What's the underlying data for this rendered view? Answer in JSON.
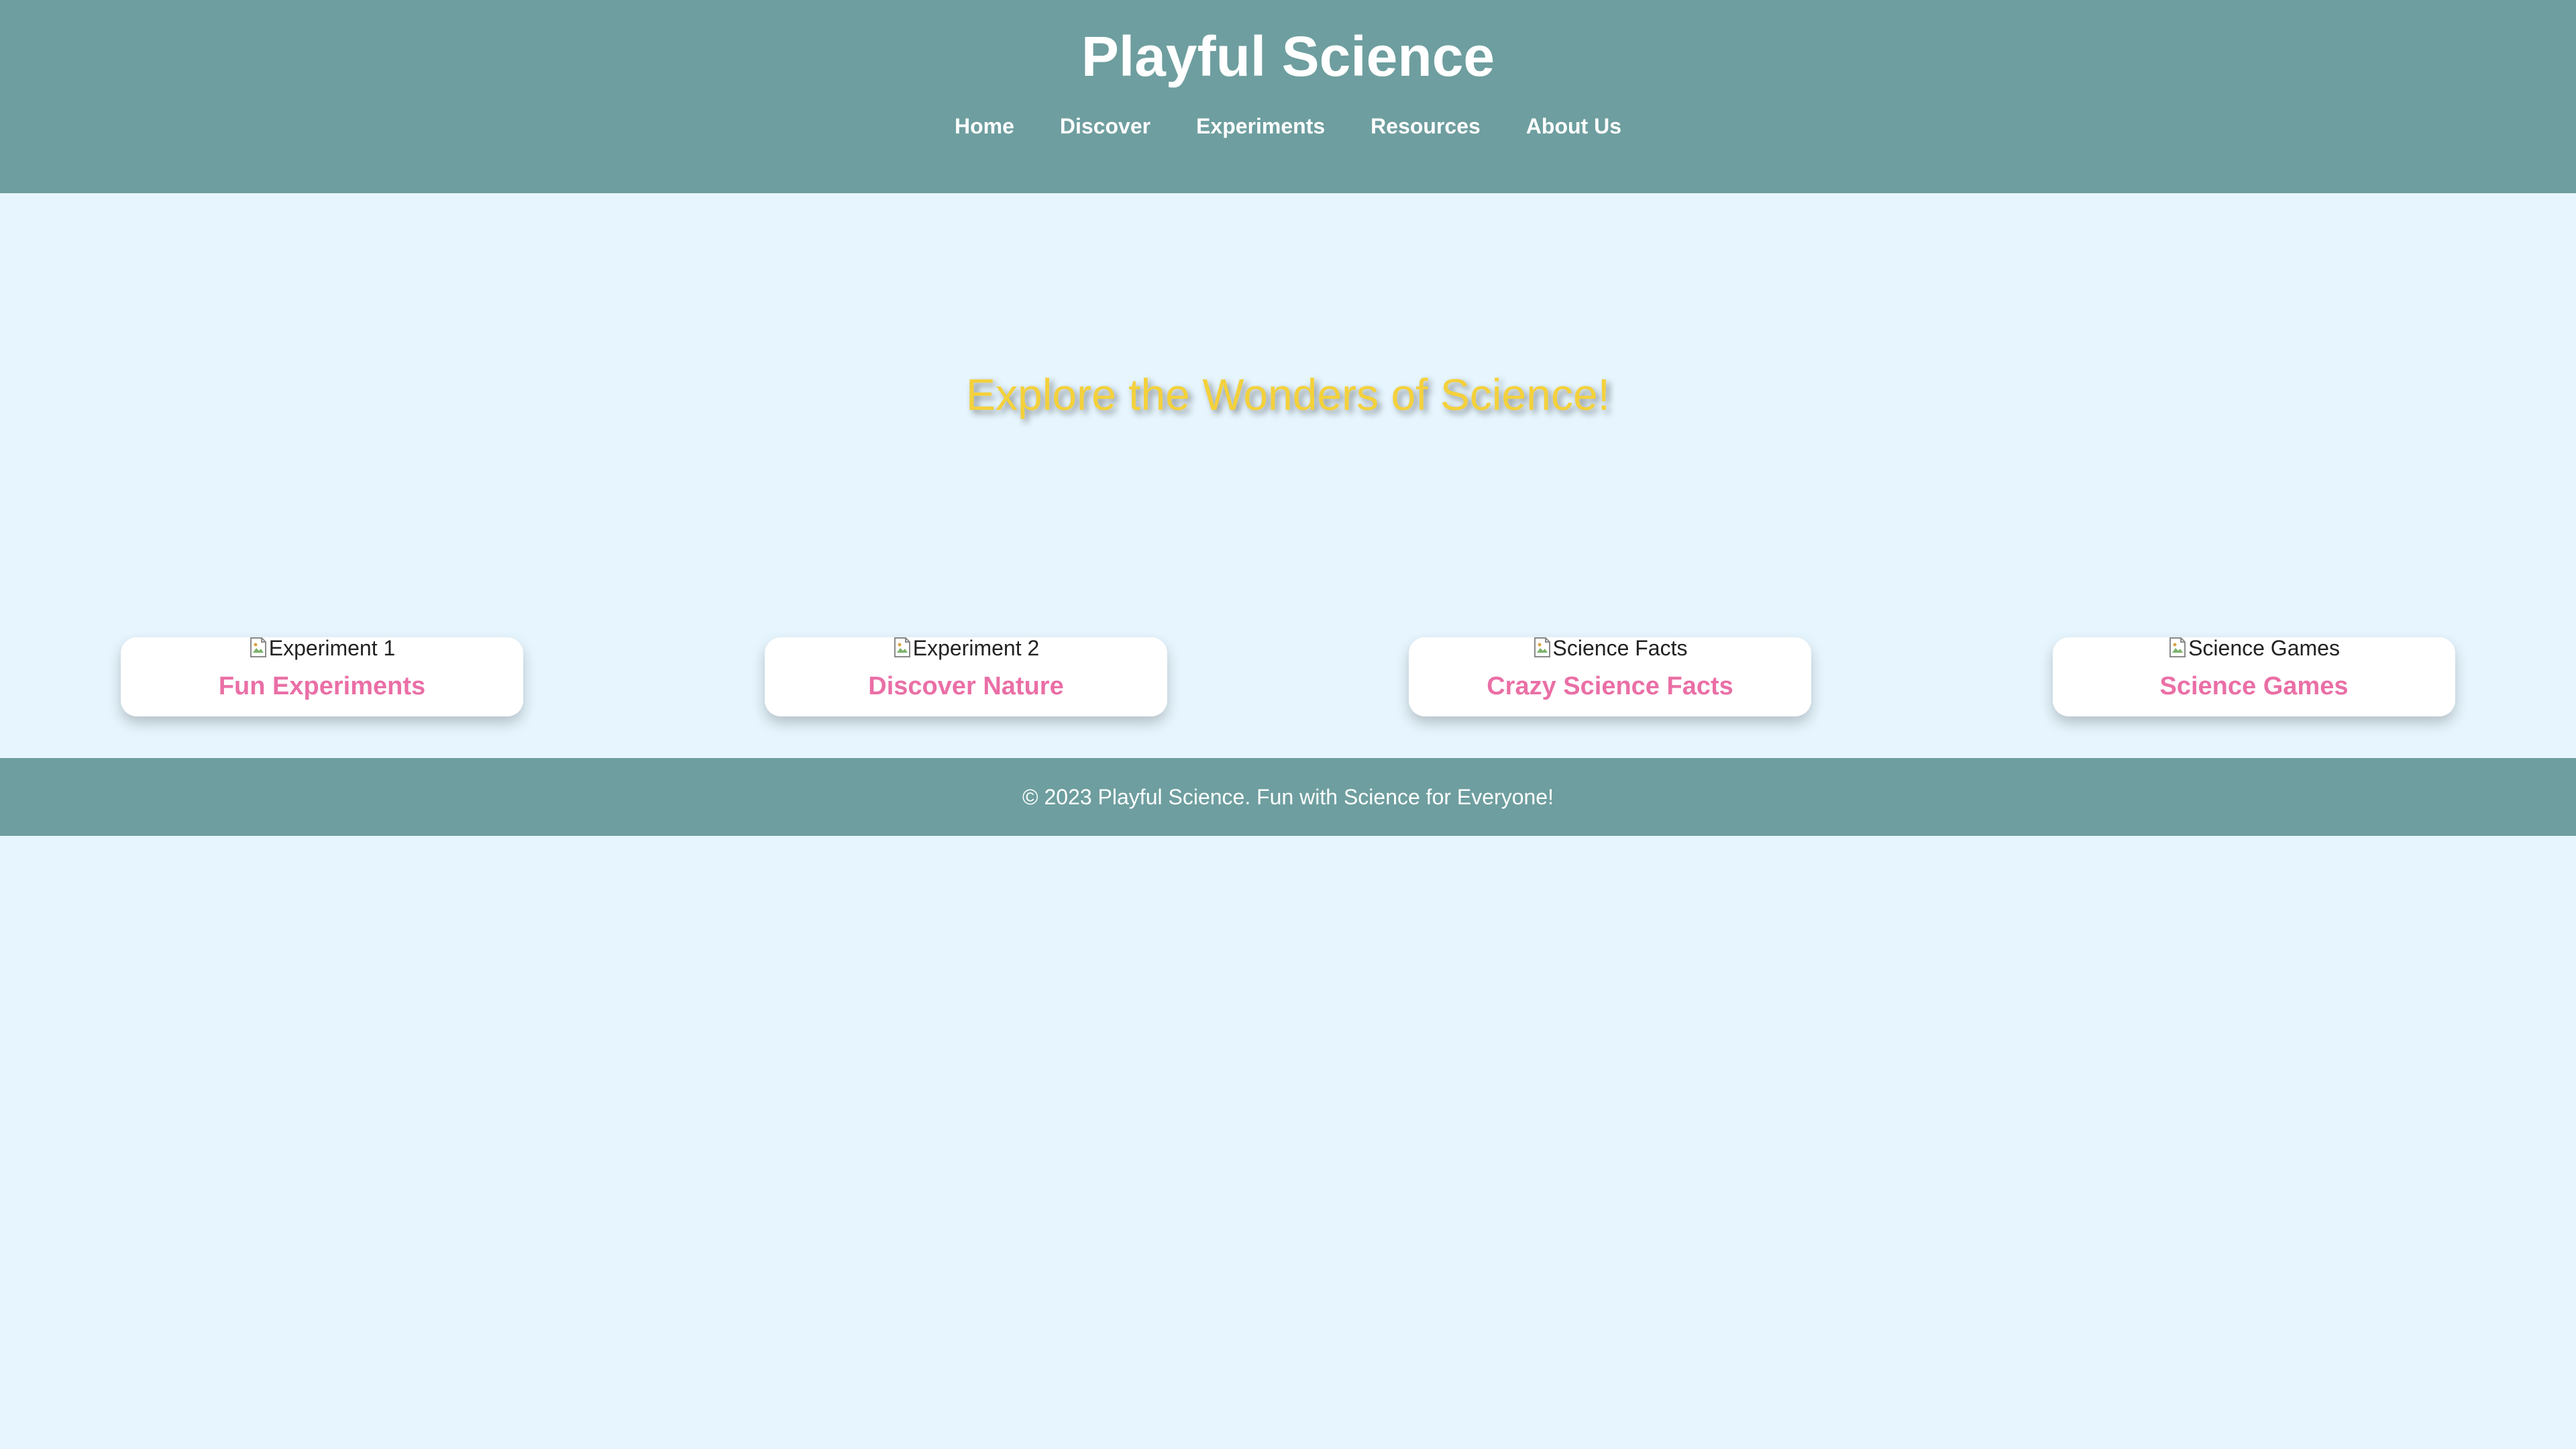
{
  "header": {
    "title": "Playful Science",
    "nav": [
      {
        "label": "Home"
      },
      {
        "label": "Discover"
      },
      {
        "label": "Experiments"
      },
      {
        "label": "Resources"
      },
      {
        "label": "About Us"
      }
    ]
  },
  "hero": {
    "heading": "Explore the Wonders of Science!"
  },
  "cards": [
    {
      "image_alt": "Experiment 1",
      "title": "Fun Experiments"
    },
    {
      "image_alt": "Experiment 2",
      "title": "Discover Nature"
    },
    {
      "image_alt": "Science Facts",
      "title": "Crazy Science Facts"
    },
    {
      "image_alt": "Science Games",
      "title": "Science Games"
    }
  ],
  "footer": {
    "text": "© 2023 Playful Science. Fun with Science for Everyone!"
  },
  "colors": {
    "header_bg": "#6e9e9f",
    "page_bg": "#e7f6fe",
    "hero_text": "#f4d13b",
    "card_title": "#ea6fa6",
    "card_bg": "#ffffff"
  },
  "icons": {
    "card_image": "broken-image-icon"
  }
}
